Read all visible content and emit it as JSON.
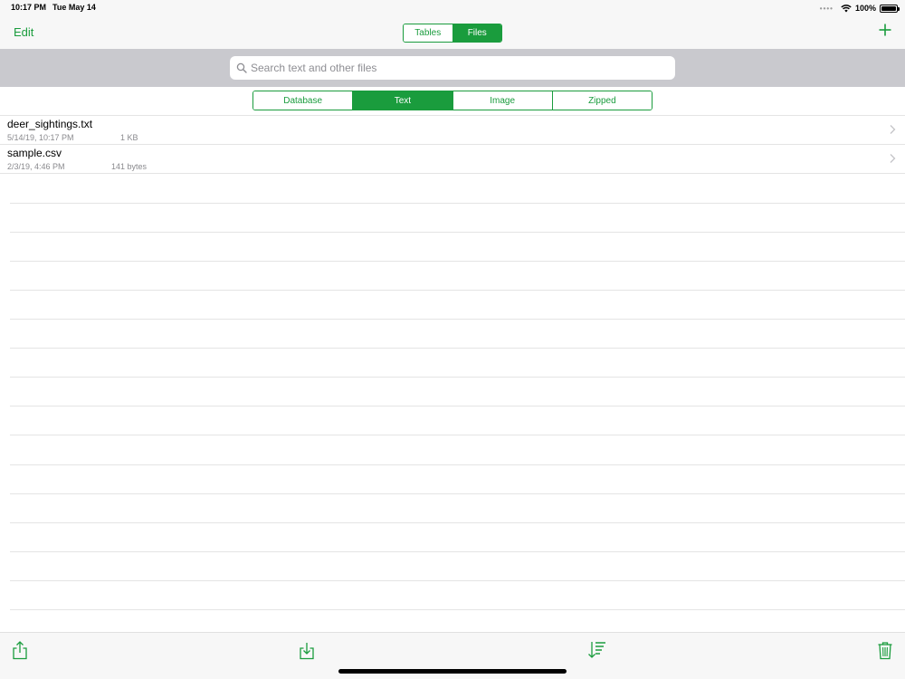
{
  "status_bar": {
    "time": "10:17 PM",
    "date": "Tue May 14",
    "battery_text": "100%",
    "icons": [
      "multitasking-dots-icon",
      "wifi-icon",
      "battery-icon"
    ]
  },
  "nav": {
    "edit_label": "Edit",
    "top_segments": [
      {
        "label": "Tables",
        "selected": false
      },
      {
        "label": "Files",
        "selected": true
      }
    ],
    "add_icon": "plus-icon"
  },
  "search": {
    "placeholder": "Search text and other files",
    "value": "",
    "icon": "search-icon"
  },
  "file_type_filter": [
    {
      "label": "Database",
      "selected": false
    },
    {
      "label": "Text",
      "selected": true
    },
    {
      "label": "Image",
      "selected": false
    },
    {
      "label": "Zipped",
      "selected": false
    }
  ],
  "files": [
    {
      "name": "deer_sightings.txt",
      "date": "5/14/19, 10:17 PM",
      "size": "1 KB"
    },
    {
      "name": "sample.csv",
      "date": "2/3/19, 4:46 PM",
      "size": "141 bytes"
    }
  ],
  "toolbar": {
    "buttons": [
      "share-icon",
      "import-icon",
      "sort-icon",
      "trash-icon"
    ]
  },
  "colors": {
    "accent": "#1a9c3d",
    "bar_background": "#f7f7f7",
    "search_area_background": "#c9c9ce",
    "secondary_text": "#8a8a8e"
  }
}
